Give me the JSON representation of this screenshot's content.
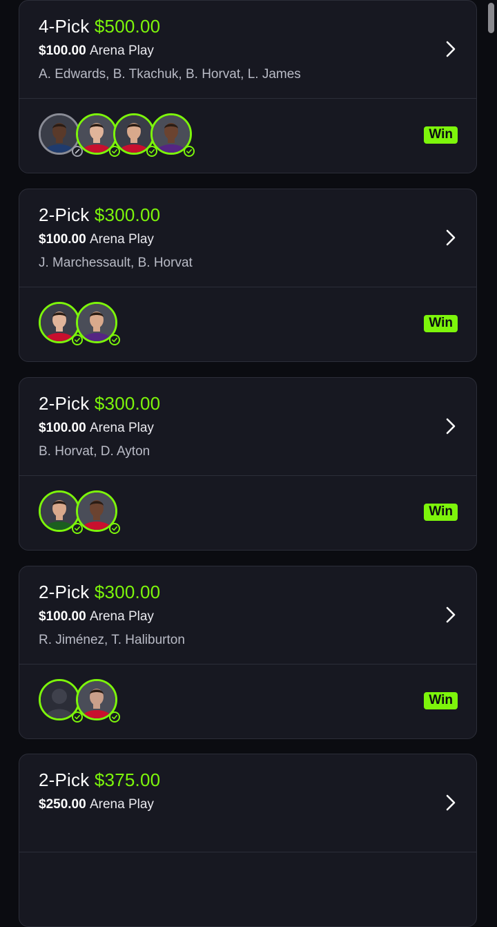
{
  "colors": {
    "accent": "#7df50b",
    "card_bg": "#171821",
    "page_bg": "#0b0c11"
  },
  "cards": [
    {
      "pick": "4-Pick",
      "payout": "$500.00",
      "stake": "$100.00",
      "play_type": "Arena Play",
      "players": "A. Edwards, B. Tkachuk, B. Horvat, L. James",
      "status": "Win",
      "avatars": [
        {
          "name": "A. Edwards",
          "result": "void"
        },
        {
          "name": "B. Tkachuk",
          "result": "hit"
        },
        {
          "name": "B. Horvat",
          "result": "hit"
        },
        {
          "name": "L. James",
          "result": "hit"
        }
      ]
    },
    {
      "pick": "2-Pick",
      "payout": "$300.00",
      "stake": "$100.00",
      "play_type": "Arena Play",
      "players": "J. Marchessault, B. Horvat",
      "status": "Win",
      "avatars": [
        {
          "name": "J. Marchessault",
          "result": "hit"
        },
        {
          "name": "B. Horvat",
          "result": "hit"
        }
      ]
    },
    {
      "pick": "2-Pick",
      "payout": "$300.00",
      "stake": "$100.00",
      "play_type": "Arena Play",
      "players": "B. Horvat, D. Ayton",
      "status": "Win",
      "avatars": [
        {
          "name": "B. Horvat",
          "result": "hit"
        },
        {
          "name": "D. Ayton",
          "result": "hit"
        }
      ]
    },
    {
      "pick": "2-Pick",
      "payout": "$300.00",
      "stake": "$100.00",
      "play_type": "Arena Play",
      "players": "R. Jiménez, T. Haliburton",
      "status": "Win",
      "avatars": [
        {
          "name": "R. Jiménez",
          "result": "hit"
        },
        {
          "name": "T. Haliburton",
          "result": "hit"
        }
      ]
    },
    {
      "pick": "2-Pick",
      "payout": "$375.00",
      "stake": "$250.00",
      "play_type": "Arena Play",
      "players": "",
      "status": "",
      "avatars": []
    }
  ]
}
